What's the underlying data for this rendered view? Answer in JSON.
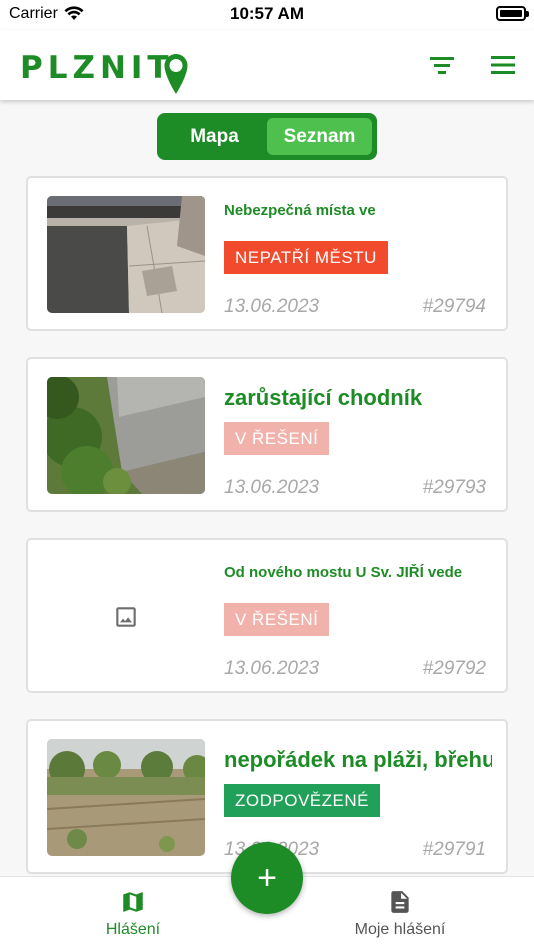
{
  "status_bar": {
    "carrier": "Carrier",
    "time": "10:57 AM"
  },
  "header": {
    "logo_text": "PLZNIT",
    "brand_color": "#1e8c26",
    "filter_icon": "filter-icon",
    "menu_icon": "hamburger-menu-icon"
  },
  "view_toggle": {
    "map_label": "Mapa",
    "list_label": "Seznam",
    "selected": "Seznam"
  },
  "reports": [
    {
      "title": "Nebezpečná místa ve",
      "status": "NEPATŘÍ MĚSTU",
      "status_color": "#f14a2c",
      "date": "13.06.2023",
      "id": "#29794",
      "image": "photo-pavement"
    },
    {
      "title": "zarůstající chodník",
      "status": "V ŘEŠENÍ",
      "status_color": "#f2b2ac",
      "date": "13.06.2023",
      "id": "#29793",
      "image": "photo-overgrown-sidewalk"
    },
    {
      "title": "Od nového mostu U Sv. JIŘÍ vede",
      "status": "V ŘEŠENÍ",
      "status_color": "#f2b2ac",
      "date": "13.06.2023",
      "id": "#29792",
      "image": "image-placeholder-icon"
    },
    {
      "title": "nepořádek na pláži, břehu",
      "status": "ZODPOVĚZENÉ",
      "status_color": "#21a05a",
      "date": "13.06.2023",
      "id": "#29791",
      "image": "photo-riverbank"
    }
  ],
  "fab": {
    "label": "+"
  },
  "tab_bar": {
    "tabs": [
      {
        "label": "Hlášení",
        "icon": "map-icon",
        "active": true
      },
      {
        "label": "Moje hlášení",
        "icon": "document-icon",
        "active": false
      }
    ]
  }
}
